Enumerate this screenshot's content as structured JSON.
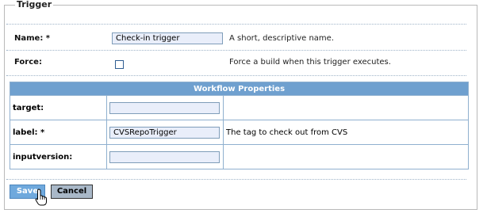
{
  "form": {
    "legend": "Trigger",
    "name": {
      "label": "Name: *",
      "value": "Check-in trigger",
      "help": "A short, descriptive name."
    },
    "force": {
      "label": "Force:",
      "checked": false,
      "help": "Force a build when this trigger executes."
    }
  },
  "workflow": {
    "header": "Workflow Properties",
    "rows": [
      {
        "label": "target:",
        "value": "",
        "help": ""
      },
      {
        "label": "label: *",
        "value": "CVSRepoTrigger",
        "help": "The tag to check out from CVS"
      },
      {
        "label": "inputversion:",
        "value": "",
        "help": ""
      }
    ]
  },
  "actions": {
    "save_label": "Save",
    "cancel_label": "Cancel"
  },
  "icons": {
    "cursor": "hand-pointer-icon"
  }
}
